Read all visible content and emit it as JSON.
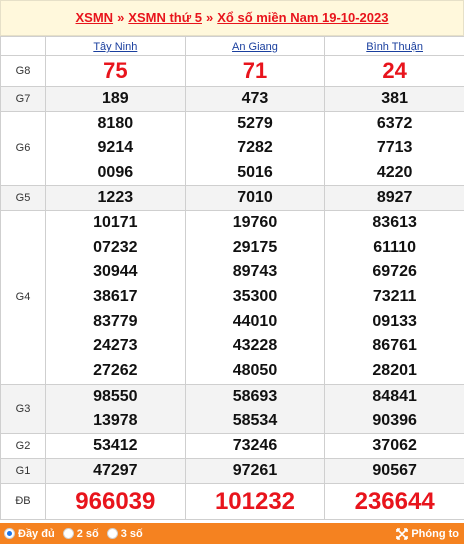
{
  "header": {
    "crumb_1": "XSMN",
    "separator": "»",
    "crumb_2": "XSMN thứ 5",
    "crumb_3": "Xổ số miền Nam 19-10-2023"
  },
  "provinces": [
    "Tây Ninh",
    "An Giang",
    "Bình Thuận"
  ],
  "rows": [
    {
      "label": "G8",
      "values": [
        [
          "75"
        ],
        [
          "71"
        ],
        [
          "24"
        ]
      ]
    },
    {
      "label": "G7",
      "values": [
        [
          "189"
        ],
        [
          "473"
        ],
        [
          "381"
        ]
      ]
    },
    {
      "label": "G6",
      "values": [
        [
          "8180",
          "9214",
          "0096"
        ],
        [
          "5279",
          "7282",
          "5016"
        ],
        [
          "6372",
          "7713",
          "4220"
        ]
      ]
    },
    {
      "label": "G5",
      "values": [
        [
          "1223"
        ],
        [
          "7010"
        ],
        [
          "8927"
        ]
      ]
    },
    {
      "label": "G4",
      "values": [
        [
          "10171",
          "07232",
          "30944",
          "38617",
          "83779",
          "24273",
          "27262"
        ],
        [
          "19760",
          "29175",
          "89743",
          "35300",
          "44010",
          "43228",
          "48050"
        ],
        [
          "83613",
          "61110",
          "69726",
          "73211",
          "09133",
          "86761",
          "28201"
        ]
      ]
    },
    {
      "label": "G3",
      "values": [
        [
          "98550",
          "13978"
        ],
        [
          "58693",
          "58534"
        ],
        [
          "84841",
          "90396"
        ]
      ]
    },
    {
      "label": "G2",
      "values": [
        [
          "53412"
        ],
        [
          "73246"
        ],
        [
          "37062"
        ]
      ]
    },
    {
      "label": "G1",
      "values": [
        [
          "47297"
        ],
        [
          "97261"
        ],
        [
          "90567"
        ]
      ]
    },
    {
      "label": "ĐB",
      "values": [
        [
          "966039"
        ],
        [
          "101232"
        ],
        [
          "236644"
        ]
      ]
    }
  ],
  "footer": {
    "option_full": "Đầy đủ",
    "option_2": "2 số",
    "option_3": "3 số",
    "zoom_label": "Phóng to"
  },
  "colors": {
    "accent_red": "#e8141c",
    "footer_orange": "#f58220",
    "link_blue": "#1a3f9e"
  }
}
